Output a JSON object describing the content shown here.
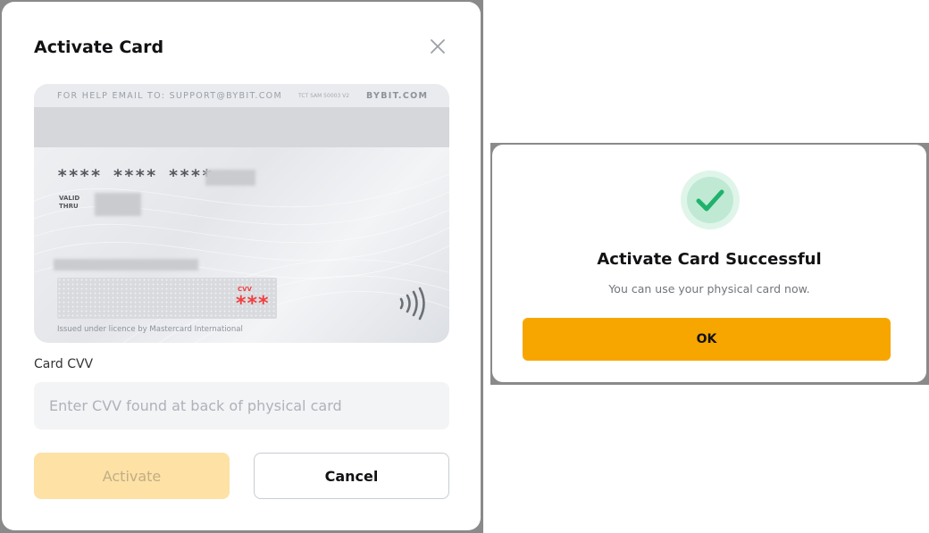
{
  "activate_modal": {
    "title": "Activate Card",
    "close_icon": "close-icon",
    "card": {
      "help_text": "FOR HELP EMAIL TO: SUPPORT@BYBIT.COM",
      "small_code": "TCT SAM 50003 V2",
      "brand": "BYBIT.COM",
      "number_masked": "**** **** ****",
      "valid_thru_label": "VALID\nTHRU",
      "cvv_label": "CVV",
      "cvv_masked": "***",
      "licence_text": "Issued under licence by Mastercard International",
      "contactless_icon": "contactless-icon"
    },
    "cvv_field": {
      "label": "Card CVV",
      "placeholder": "Enter CVV found at back of physical card",
      "value": ""
    },
    "activate_label": "Activate",
    "cancel_label": "Cancel"
  },
  "success_dialog": {
    "icon": "check-circle-icon",
    "title": "Activate Card Successful",
    "message": "You can use your physical card now.",
    "ok_label": "OK"
  },
  "colors": {
    "accent": "#f7a600",
    "accent_disabled": "#fde1a5",
    "success": "#20b26c",
    "cvv_red": "#f04040"
  }
}
